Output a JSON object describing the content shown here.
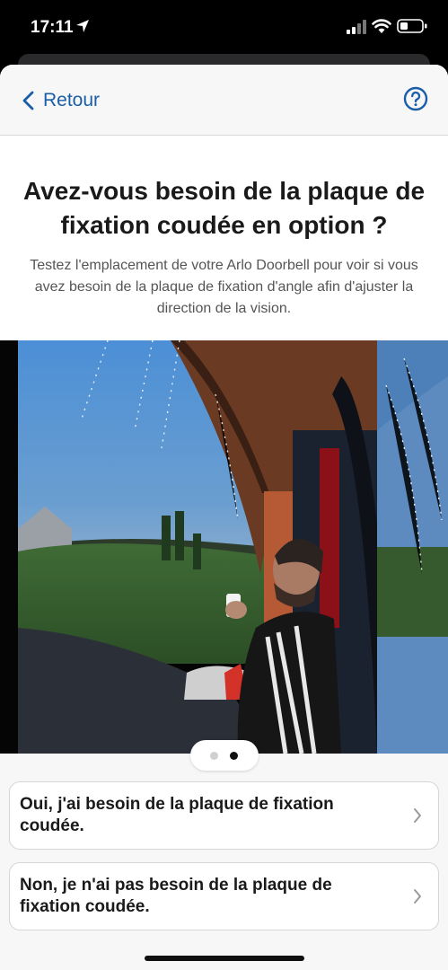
{
  "status_bar": {
    "time": "17:11"
  },
  "nav": {
    "back_label": "Retour"
  },
  "header": {
    "title": "Avez-vous besoin de la plaque de fixation coudée en option ?",
    "subtitle": "Testez l'emplacement de votre Arlo Doorbell pour voir si vous avez besoin de la plaque de fixation d'angle afin d'ajuster la direction de la vision."
  },
  "carousel": {
    "page_count": 2,
    "current_page": 2
  },
  "options": [
    {
      "label": "Oui, j'ai besoin de la plaque de fixation coudée."
    },
    {
      "label": "Non, je n'ai pas besoin de la plaque de fixation coudée."
    }
  ],
  "colors": {
    "accent": "#1a5ea8",
    "sheet_background": "#f7f7f7"
  }
}
